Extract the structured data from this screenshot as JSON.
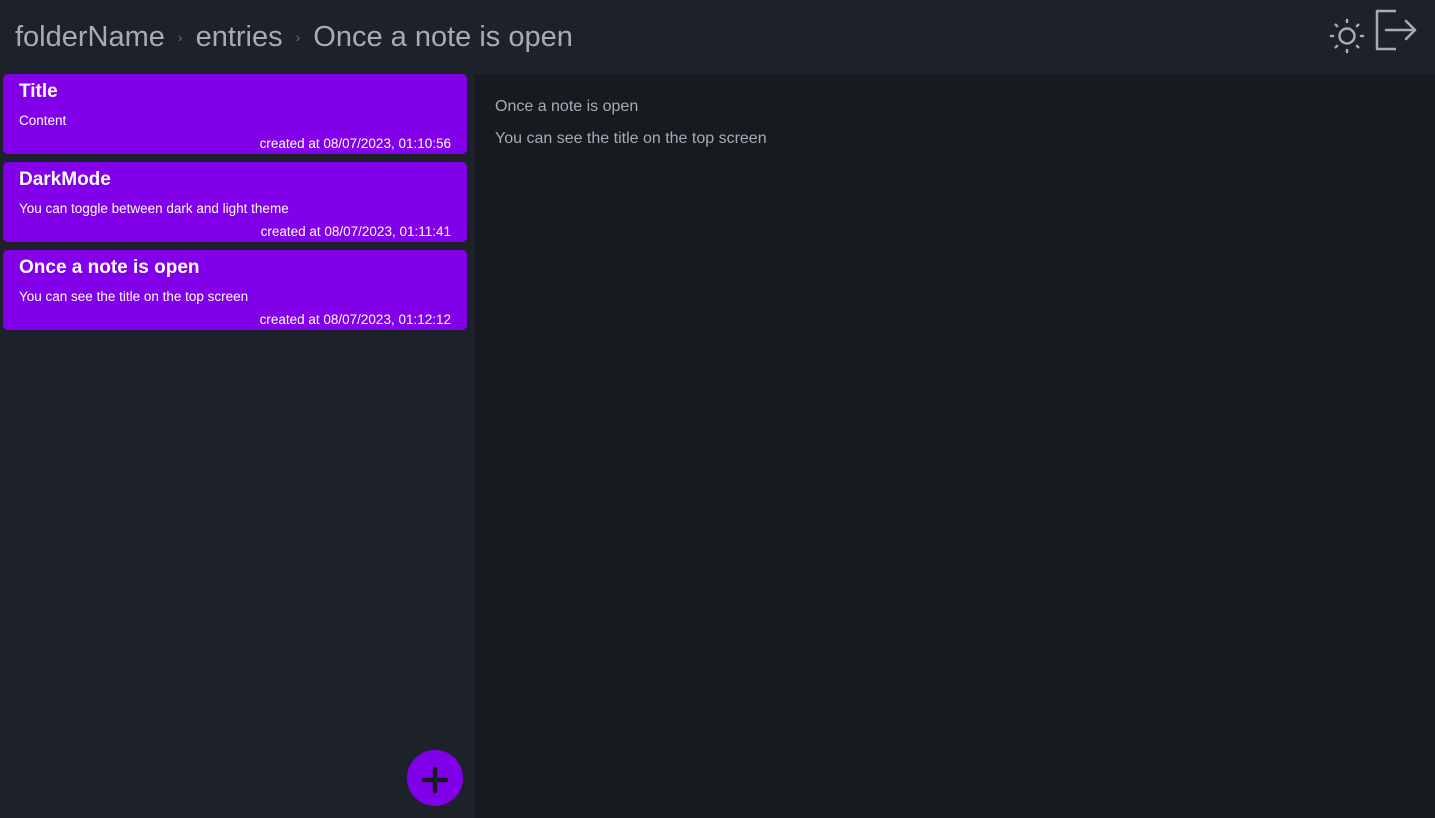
{
  "header": {
    "breadcrumb": [
      {
        "label": "folderName"
      },
      {
        "label": "entries"
      },
      {
        "label": "Once a note is open"
      }
    ],
    "separator": "›",
    "theme_toggle_icon": "sun-icon",
    "logout_icon": "logout-icon"
  },
  "notes": [
    {
      "title": "Title",
      "content": "Content",
      "created": "created at 08/07/2023, 01:10:56"
    },
    {
      "title": "DarkMode",
      "content": "You can toggle between dark and light theme",
      "created": "created at 08/07/2023, 01:11:41"
    },
    {
      "title": "Once a note is open",
      "content": "You can see the title on the top screen",
      "created": "created at 08/07/2023, 01:12:12"
    }
  ],
  "editor": {
    "title": "Once a note is open",
    "body": "You can see the title on the top screen"
  },
  "add_button_icon": "plus-icon",
  "colors": {
    "accent": "#8200e9",
    "header_bg": "#1d222a",
    "main_bg": "#171b20",
    "text_muted": "#a6acb6"
  }
}
